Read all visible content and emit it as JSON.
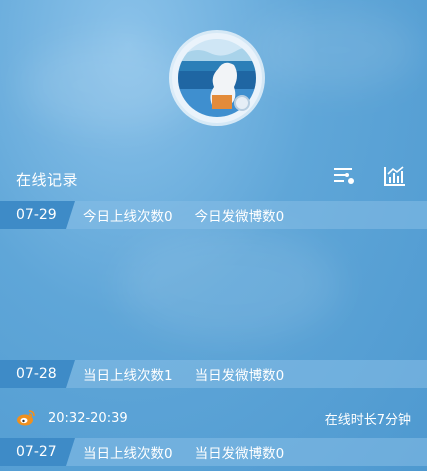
{
  "header": {
    "title": "在线记录"
  },
  "icons": {
    "filter": "filter-sliders-icon",
    "chart": "bar-chart-icon",
    "weibo": "weibo-logo-icon"
  },
  "days": [
    {
      "date": "07-29",
      "login_label": "今日上线次数0",
      "posts_label": "今日发微博数0"
    },
    {
      "date": "07-28",
      "login_label": "当日上线次数1",
      "posts_label": "当日发微博数0"
    },
    {
      "date": "07-27",
      "login_label": "当日上线次数0",
      "posts_label": "当日发微博数0"
    }
  ],
  "session": {
    "time_range": "20:32-20:39",
    "duration": "在线时长7分钟"
  },
  "colors": {
    "accent_date_tab": "#3e8bc7",
    "row_background": "#87bee6",
    "weibo_orange": "#f0901e"
  }
}
